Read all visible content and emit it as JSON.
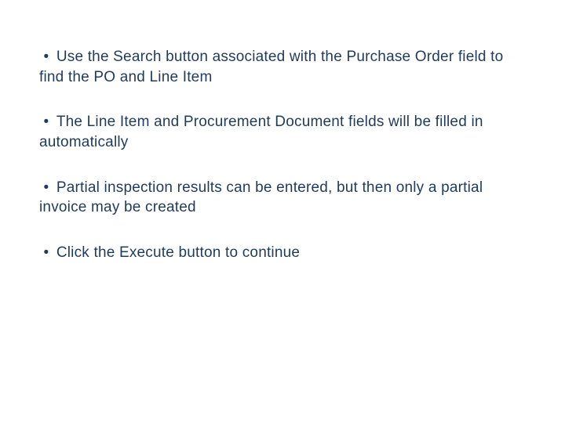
{
  "bullets": {
    "item0": "Use the Search button associated with the Purchase Order field to find the PO and Line Item",
    "item1": "The Line Item and Procurement Document fields will be filled in automatically",
    "item2": "Partial inspection results can be entered, but then only a partial invoice may be created",
    "item3": "Click the Execute button to continue"
  },
  "bullet_glyph": "•"
}
